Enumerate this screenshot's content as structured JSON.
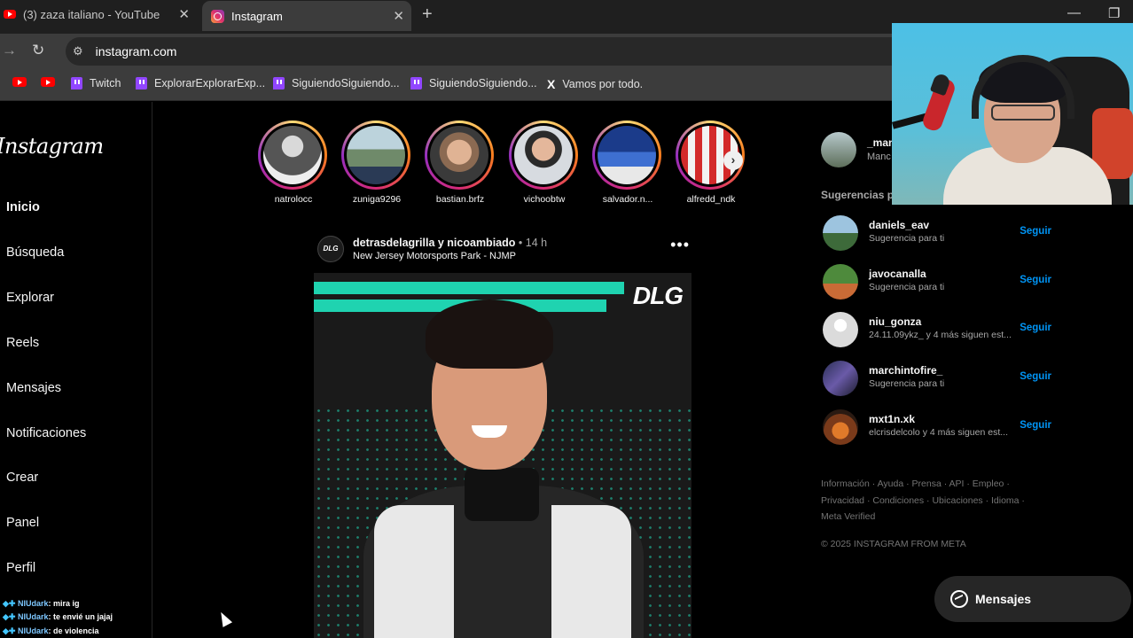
{
  "browser": {
    "tabs": [
      {
        "title": "(3) zaza italiano - YouTube",
        "icon": "youtube-icon"
      },
      {
        "title": "Instagram",
        "icon": "instagram-icon"
      }
    ],
    "url": "instagram.com",
    "bookmarks": [
      "Twitch",
      "ExplorarExplorarExp...",
      "SiguiendoSiguiendo...",
      "SiguiendoSiguiendo...",
      "Vamos por todo."
    ]
  },
  "nav": {
    "logo": "Instagram",
    "items": [
      "Inicio",
      "Búsqueda",
      "Explorar",
      "Reels",
      "Mensajes",
      "Notificaciones",
      "Crear",
      "Panel",
      "Perfil"
    ]
  },
  "stories": [
    {
      "name": "natrolocc"
    },
    {
      "name": "zuniga9296"
    },
    {
      "name": "bastian.brfz"
    },
    {
      "name": "vichoobtw"
    },
    {
      "name": "salvador.n..."
    },
    {
      "name": "alfredd_ndk"
    }
  ],
  "post": {
    "users": "detrasdelagrilla y nicoambiado",
    "time": "• 14 h",
    "location": "New Jersey Motorsports Park - NJMP",
    "avatar_text": "DLG",
    "media_logo": "DLG"
  },
  "profile": {
    "user": "_man",
    "name": "Manc"
  },
  "suggestions_title": "Sugerencias p",
  "suggestions": [
    {
      "user": "daniels_eav",
      "sub": "Sugerencia para ti",
      "action": "Seguir"
    },
    {
      "user": "javocanalla",
      "sub": "Sugerencia para ti",
      "action": "Seguir"
    },
    {
      "user": "niu_gonza",
      "sub": "24.11.09ykz_ y 4 más siguen est...",
      "action": "Seguir"
    },
    {
      "user": "marchintofire_",
      "sub": "Sugerencia para ti",
      "action": "Seguir"
    },
    {
      "user": "mxt1n.xk",
      "sub": "elcrisdelcolo y 4 más siguen est...",
      "action": "Seguir"
    }
  ],
  "footer": {
    "line1": "Información · Ayuda · Prensa · API · Empleo ·",
    "line2": "Privacidad · Condiciones · Ubicaciones · Idioma ·",
    "line3": "Meta Verified",
    "copyright": "© 2025 INSTAGRAM FROM META"
  },
  "messages_label": "Mensajes",
  "chat": [
    {
      "user": "NIUdark",
      "text": ": mira ig"
    },
    {
      "user": "NIUdark",
      "text": ": te envié un jajaj"
    },
    {
      "user": "NIUdark",
      "text": ": de violencia"
    }
  ],
  "colors": {
    "link_blue": "#0095f6",
    "accent_teal": "#1fd3b0",
    "tab_active": "#3c3c3c"
  }
}
